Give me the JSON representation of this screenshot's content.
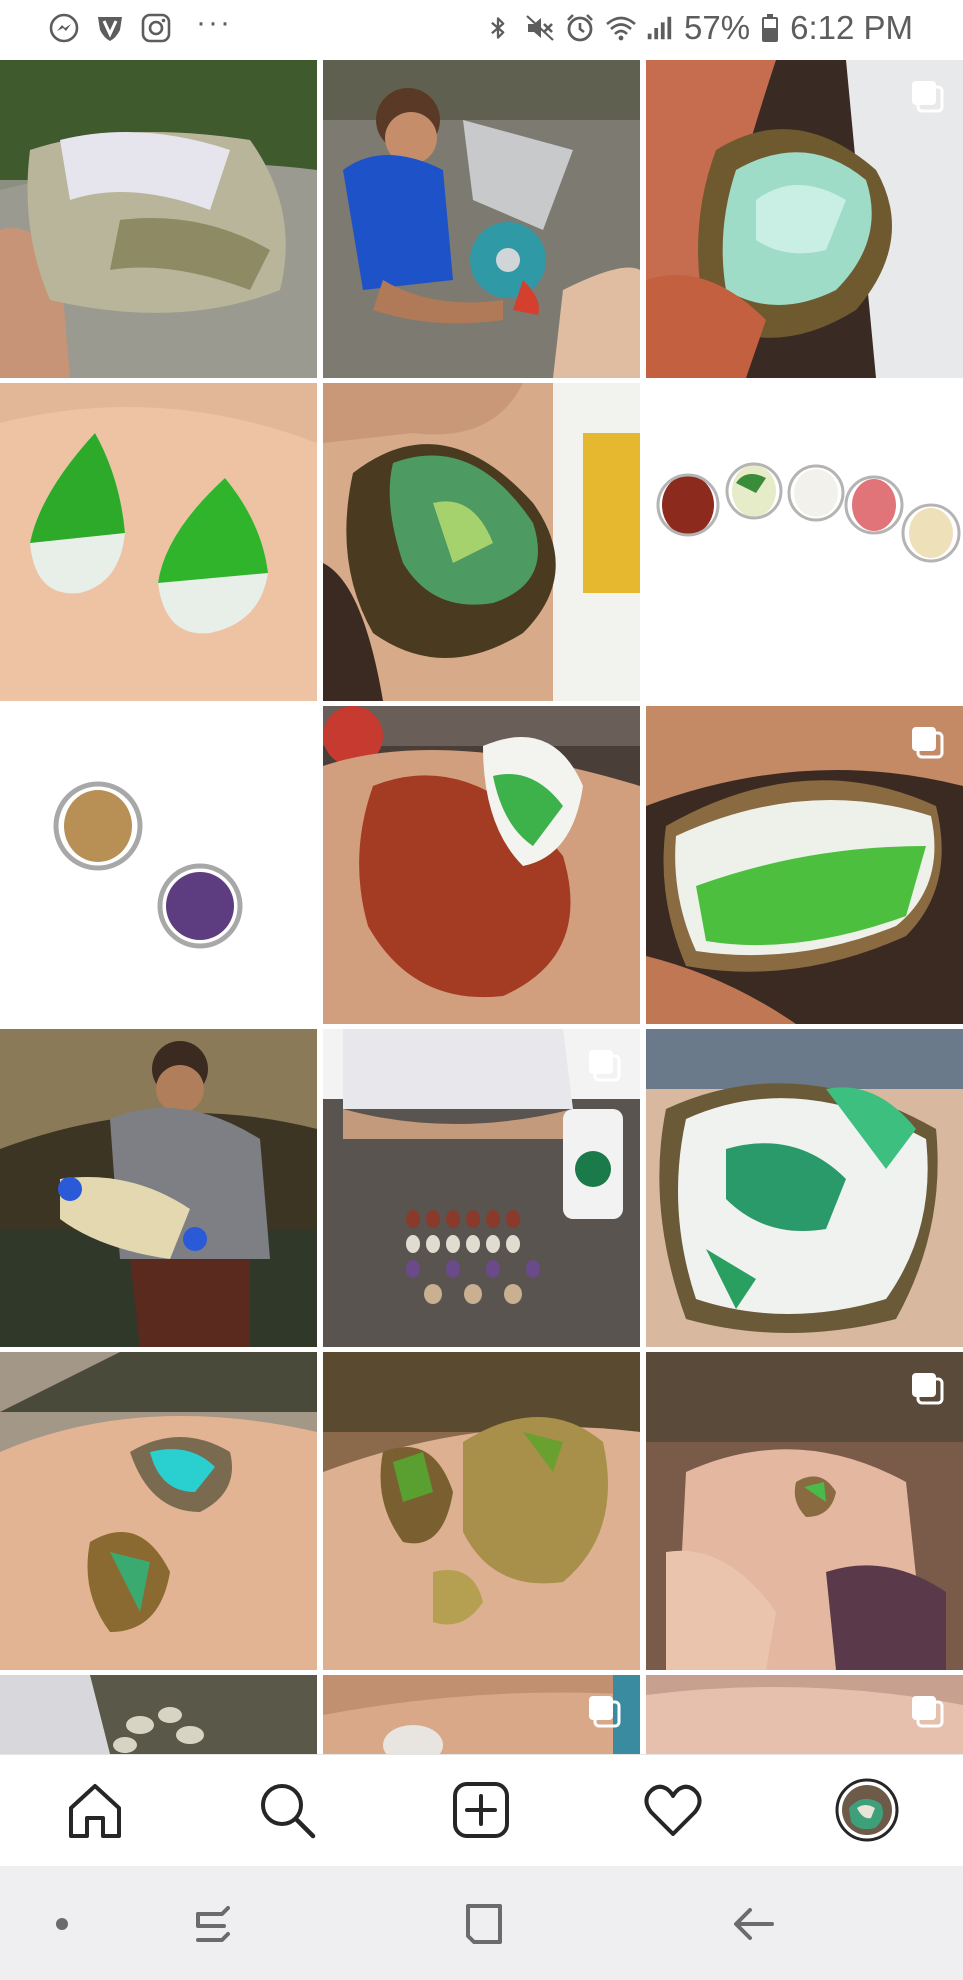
{
  "status_bar": {
    "battery": "57%",
    "time": "6:12 PM",
    "left_icons": [
      "messenger-icon",
      "vpn-shield-icon",
      "instagram-icon",
      "more-dots-icon"
    ],
    "right_icons": [
      "bluetooth-icon",
      "mute-icon",
      "alarm-icon",
      "wifi-icon",
      "signal-icon",
      "battery-icon"
    ]
  },
  "grid": {
    "posts": [
      {
        "subject": "quartz-crystal-rock",
        "multi": false
      },
      {
        "subject": "boy-with-grinder",
        "multi": false
      },
      {
        "subject": "green-white-stone",
        "multi": true
      },
      {
        "subject": "green-cabochons",
        "multi": false
      },
      {
        "subject": "green-brown-stone",
        "multi": false
      },
      {
        "subject": "row-of-gem-rings",
        "multi": false
      },
      {
        "subject": "two-rings",
        "multi": false
      },
      {
        "subject": "red-jasper-and-green-stone",
        "multi": false
      },
      {
        "subject": "green-white-rough-stone",
        "multi": true
      },
      {
        "subject": "man-holding-rock-in-stream",
        "multi": false
      },
      {
        "subject": "cabochons-on-table",
        "multi": true
      },
      {
        "subject": "white-green-crystal",
        "multi": false
      },
      {
        "subject": "blue-green-minerals-in-hand",
        "multi": false
      },
      {
        "subject": "green-mineral-nuggets",
        "multi": false
      },
      {
        "subject": "small-green-nugget",
        "multi": true
      },
      {
        "subject": "rocks-partial",
        "multi": false
      },
      {
        "subject": "hand-partial",
        "multi": true
      },
      {
        "subject": "finger-partial",
        "multi": true
      }
    ]
  },
  "bottom_nav": {
    "items": [
      "home-icon",
      "search-icon",
      "new-post-icon",
      "activity-heart-icon",
      "profile-avatar"
    ]
  },
  "system_nav": {
    "items": [
      "recent-dot",
      "recents-button",
      "home-button",
      "back-button"
    ]
  },
  "colors": {
    "status_text": "#5d5d5d",
    "nav_icon": "#262626",
    "system_nav_bg": "#efeff1",
    "system_nav_icon": "#6b6b6b"
  }
}
